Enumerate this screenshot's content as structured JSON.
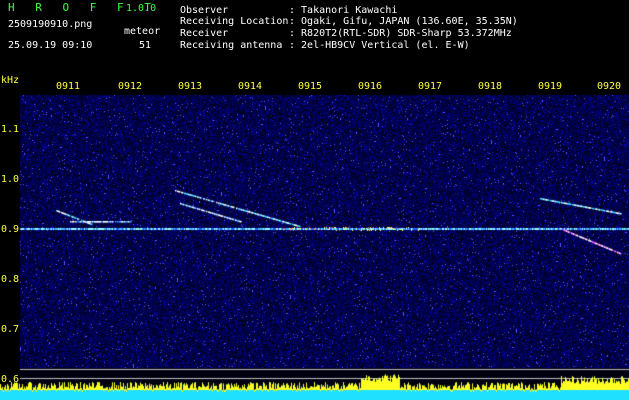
{
  "app": {
    "name": "H R O F F T",
    "version": "1.0.0"
  },
  "file": {
    "name": "2509190910.png",
    "datetime": "25.09.19 09:10"
  },
  "meteor": {
    "label": "meteor",
    "count": "51"
  },
  "info": [
    {
      "label": "Observer",
      "value": ": Takanori Kawachi"
    },
    {
      "label": "Receiving Location",
      "value": ": Ogaki, Gifu, JAPAN (136.60E, 35.35N)"
    },
    {
      "label": "Receiver",
      "value": ": R820T2(RTL-SDR) SDR-Sharp 53.372MHz"
    },
    {
      "label": "Receiving antenna",
      "value": ": 2el-HB9CV Vertical (el. E-W)"
    }
  ],
  "axis": {
    "unit": "kHz",
    "time_ticks": [
      "0911",
      "0912",
      "0913",
      "0914",
      "0915",
      "0916",
      "0917",
      "0918",
      "0919",
      "0920"
    ],
    "freq_ticks": [
      "1.1",
      "1.0",
      "0.9",
      "0.8",
      "0.7",
      "0.6"
    ]
  },
  "colors": {
    "label_yellow": "#ffff40",
    "title_green": "#3cff3c",
    "background": "#000010",
    "trace_cyan": "#40e0ff"
  }
}
